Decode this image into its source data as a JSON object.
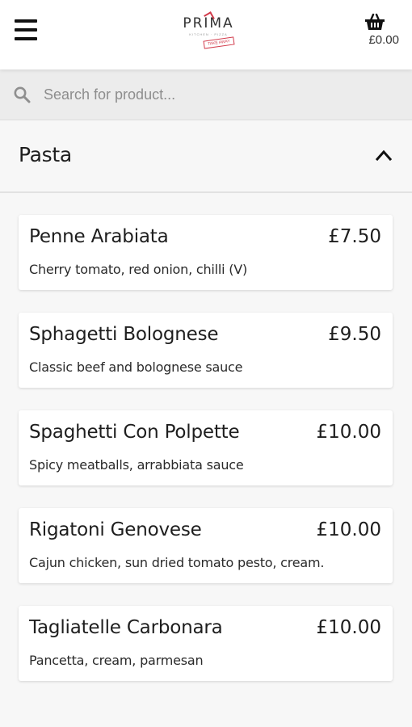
{
  "header": {
    "logo_text": "PRIMA",
    "logo_subtext": "KITCHEN · PIZZA",
    "logo_stamp": "TAKE AWAY",
    "cart_total": "£0.00"
  },
  "search": {
    "placeholder": "Search for product..."
  },
  "category": {
    "title": "Pasta"
  },
  "products": [
    {
      "name": "Penne Arabiata",
      "price": "£7.50",
      "description": "Cherry tomato, red onion, chilli (V)"
    },
    {
      "name": "Sphagetti Bolognese",
      "price": "£9.50",
      "description": "Classic beef and bolognese sauce"
    },
    {
      "name": "Spaghetti Con Polpette",
      "price": "£10.00",
      "description": "Spicy meatballs, arrabbiata sauce"
    },
    {
      "name": "Rigatoni Genovese",
      "price": "£10.00",
      "description": "Cajun chicken, sun dried tomato pesto, cream."
    },
    {
      "name": "Tagliatelle Carbonara",
      "price": "£10.00",
      "description": "Pancetta, cream, parmesan"
    }
  ],
  "colors": {
    "brand_accent": "#d23b4b",
    "page_background": "#f7f7f7",
    "search_background": "#ececec"
  },
  "icons": {
    "menu": "hamburger-menu-icon",
    "cart": "basket-icon",
    "search": "search-icon",
    "collapse": "chevron-up-icon"
  }
}
